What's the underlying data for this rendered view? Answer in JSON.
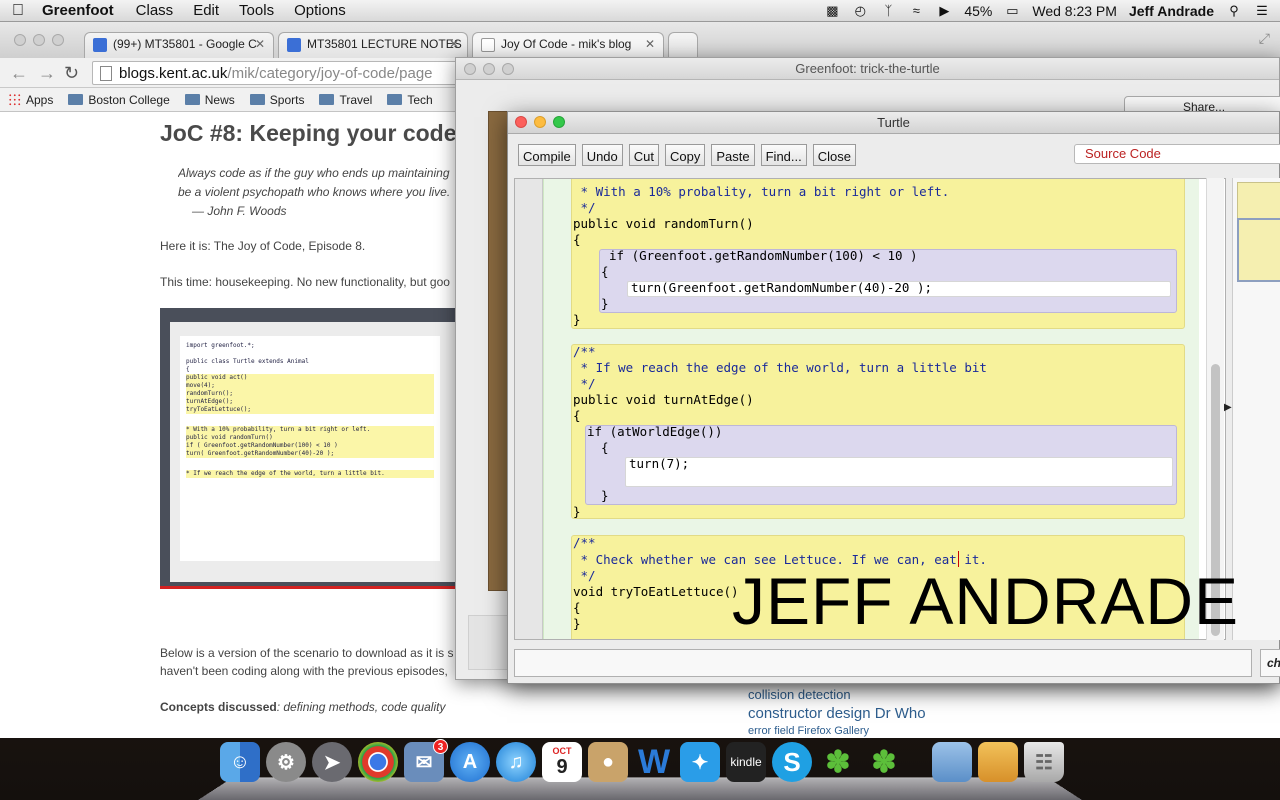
{
  "menubar": {
    "app_name": "Greenfoot",
    "items": [
      "Class",
      "Edit",
      "Tools",
      "Options"
    ],
    "battery": "45%",
    "clock": "Wed 8:23 PM",
    "user": "Jeff Andrade"
  },
  "browser": {
    "tabs": [
      {
        "label": "(99+) MT35801 - Google C",
        "favicon_color": "#3b6fd6"
      },
      {
        "label": "MT35801 LECTURE NOTES",
        "favicon_color": "#3b6fd6"
      },
      {
        "label": "Joy Of Code - mik's blog",
        "favicon_color": "#cccccc"
      }
    ],
    "url_host": "blogs.kent.ac.uk",
    "url_path": "/mik/category/joy-of-code/page",
    "bookmarks": [
      "Apps",
      "Boston College",
      "News",
      "Sports",
      "Travel",
      "Tech"
    ]
  },
  "blog": {
    "title": "JoC #8: Keeping your code",
    "quote_line1": "Always code as if the guy who ends up maintaining",
    "quote_line2": "be a violent psychopath who knows where you live.",
    "quote_author": "— John F. Woods",
    "para1": "Here it is: The Joy of Code, Episode 8.",
    "para2": "This time: housekeeping. No new functionality, but goo",
    "para3a": "Below is a version of the scenario to download as it is s",
    "para3b": "haven't been coding along with the previous episodes,",
    "concepts_label": "Concepts discussed",
    "concepts_value": ": defining methods, code quality",
    "tags": {
      "tag1": "collision detection",
      "tag2": "constructor design Dr Who",
      "tag3": "error field Firefox Gallery"
    },
    "thumb_code": {
      "l1": "import greenfoot.*;",
      "l2": "public class Turtle extends Animal",
      "l3": "{",
      "l4": "    public void act()",
      "l5": "        move(4);",
      "l6": "        randomTurn();",
      "l7": "        turnAtEdge();",
      "l8": "        tryToEatLettuce();",
      "l9": "     * With a 10% probability, turn a bit right or left.",
      "l10": "    public void randomTurn()",
      "l11": "        if ( Greenfoot.getRandomNumber(100) < 10 )",
      "l12": "            turn( Greenfoot.getRandomNumber(40)-20 );",
      "l13": "     * If we reach the edge of the world, turn a little bit."
    }
  },
  "greenfoot_main": {
    "title": "Greenfoot: trick-the-turtle",
    "share_label": "Share..."
  },
  "editor": {
    "title": "Turtle",
    "buttons": {
      "compile": "Compile",
      "undo": "Undo",
      "cut": "Cut",
      "copy": "Copy",
      "paste": "Paste",
      "find": "Find...",
      "close": "Close"
    },
    "view_select": "Source Code",
    "status_right": "ch",
    "code": {
      "l1": " * With a 10% probality, turn a bit right or left.",
      "l2": " */",
      "l3": "public void randomTurn()",
      "l4": "{",
      "l5": "if (Greenfoot.getRandomNumber(100) < 10 )",
      "l6": "{",
      "l7": "turn(Greenfoot.getRandomNumber(40)-20 );",
      "l8": "}",
      "l9": "}",
      "l10": "/**",
      "l11": " * If we reach the edge of the world, turn a little bit",
      "l12": " */",
      "l13": "public void turnAtEdge()",
      "l14": "{",
      "l15": "if (atWorldEdge())",
      "l16": "{",
      "l17": "turn(7);",
      "l18": "}",
      "l19": "}",
      "l20": "/**",
      "l21": " * Check whether we can see Lettuce. If we can, eat it.",
      "l22": " */",
      "l23": "void tryToEatLettuce()",
      "l24": "{",
      "l25": "}"
    }
  },
  "watermark": "JEFF ANDRADE",
  "dock": {
    "mail_badge": "3",
    "calendar_month": "OCT",
    "calendar_day": "9",
    "kindle_label": "kindle"
  }
}
